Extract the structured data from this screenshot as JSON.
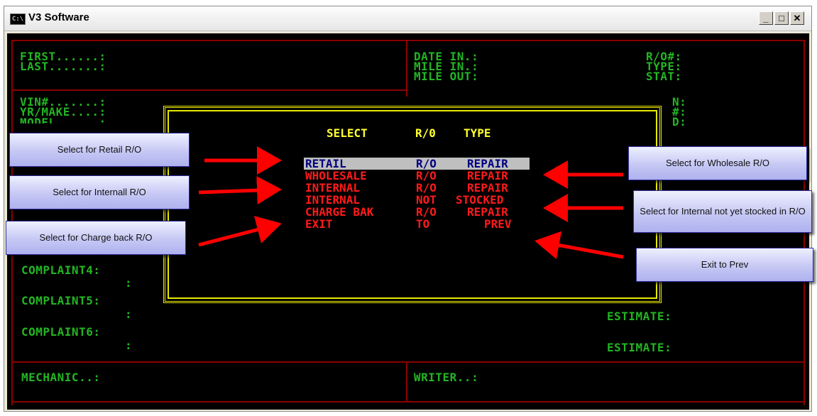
{
  "window": {
    "title": "V3 Software",
    "icon": "C:\\",
    "buttons": {
      "minimize": "_",
      "maximize": "□",
      "close": "✕"
    }
  },
  "form": {
    "first": "FIRST......:",
    "last": "LAST.......:",
    "vin": "VIN#.......:",
    "yrmake": "YR/MAKE....:",
    "model": "MODEL......:",
    "date_in": "DATE IN.:",
    "mile_in": "MILE IN.:",
    "mile_out": "MILE OUT:",
    "ro_num": "R/O#:",
    "type": "TYPE:",
    "stat": "STAT:",
    "right_partial": [
      "N:",
      "#:",
      "D:"
    ],
    "right_partial_low": "E:",
    "complaint4": "COMPLAINT4:",
    "complaint5": "COMPLAINT5:",
    "complaint6": "COMPLAINT6:",
    "colon": ":",
    "estimate": "ESTIMATE:",
    "mechanic": "MECHANIC..:",
    "writer": "WRITER..:"
  },
  "dialog": {
    "header": [
      "SELECT",
      "R/0",
      "TYPE"
    ],
    "options": [
      {
        "c1": "RETAIL",
        "c2": "R/O",
        "c3": "REPAIR",
        "selected": true
      },
      {
        "c1": "WHOLESALE",
        "c2": "R/O",
        "c3": "REPAIR",
        "selected": false
      },
      {
        "c1": "INTERNAL",
        "c2": "R/O",
        "c3": "REPAIR",
        "selected": false
      },
      {
        "c1": "INTERNAL",
        "c2": "NOT",
        "c3": "STOCKED",
        "selected": false
      },
      {
        "c1": "CHARGE BAK",
        "c2": "R/O",
        "c3": "REPAIR",
        "selected": false
      },
      {
        "c1": "EXIT",
        "c2": "TO",
        "c3": "PREV",
        "selected": false
      }
    ]
  },
  "callouts": {
    "retail": "Select for Retail R/O",
    "internal": "Select for Internall R/O",
    "chargeback": "Select for Charge back R/O",
    "wholesale": "Select for Wholesale R/O",
    "notstocked": "Select for Internal not yet stocked in R/O",
    "exit": "Exit to Prev"
  },
  "colors": {
    "console_bg": "#000000",
    "field_text": "#23b523",
    "dialog_border": "#e8e800",
    "option_text": "#ff1a1a",
    "selected_bg": "#bfbfbf",
    "selected_text": "#000080",
    "arrow": "#ff0000"
  }
}
